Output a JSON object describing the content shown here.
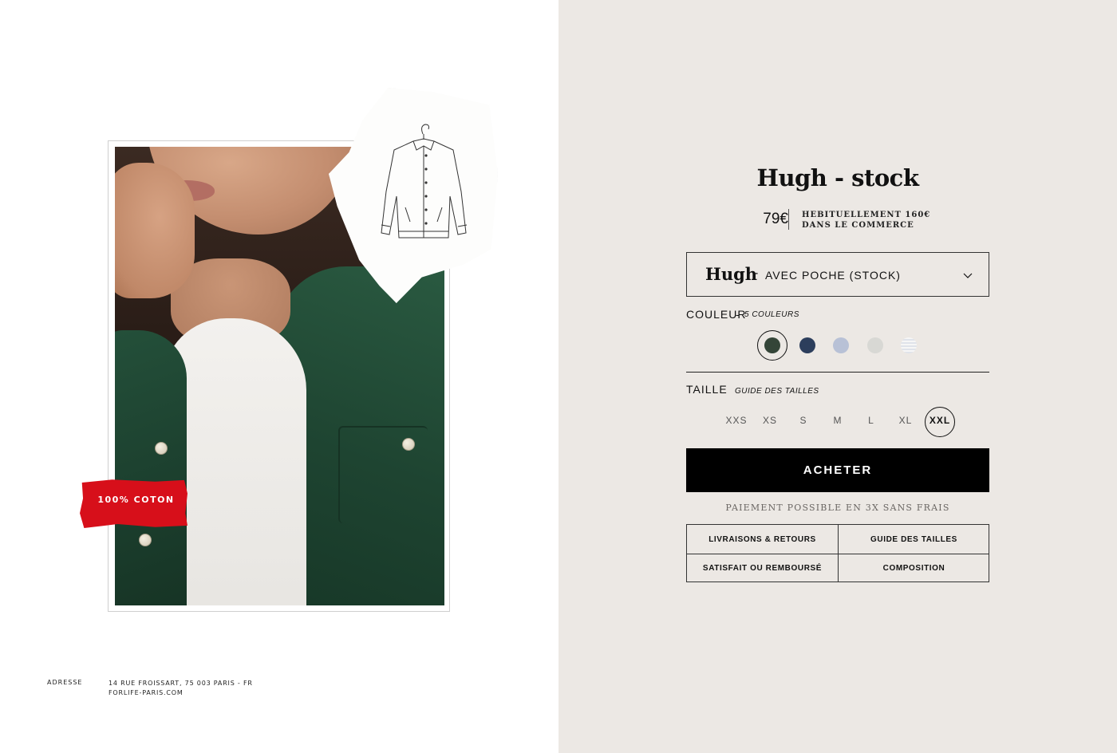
{
  "product": {
    "title": "Hugh - stock",
    "price": "79€",
    "price_note_line1": "HEBITUELLEMENT 160€",
    "price_note_line2": "DANS LE COMMERCE"
  },
  "selector": {
    "name": "Hugh",
    "dash": "-",
    "variant": "AVEC POCHE (STOCK)",
    "icon": "chevron-down-icon"
  },
  "color_section": {
    "label": "COULEUR",
    "separator": "-",
    "sub": "5 COULEURS",
    "swatches": [
      {
        "color": "#344538",
        "selected": true
      },
      {
        "color": "#2c3e5c",
        "selected": false
      },
      {
        "color": "#b8c1d6",
        "selected": false
      },
      {
        "color": "#d8d8d4",
        "selected": false
      },
      {
        "color": "#dfe3ea",
        "selected": false,
        "striped": true
      }
    ]
  },
  "size_section": {
    "label": "TAILLE",
    "guide_link": "GUIDE DES TAILLES",
    "sizes": [
      "XXS",
      "XS",
      "S",
      "M",
      "L",
      "XL",
      "XXL"
    ],
    "selected": "XXL"
  },
  "buy_button": "ACHETER",
  "payment_note": "PAIEMENT POSSIBLE EN 3X SANS FRAIS",
  "info_links": [
    "LIVRAISONS & RETOURS",
    "GUIDE DES TAILLES",
    "SATISFAIT OU REMBOURSÉ",
    "COMPOSITION"
  ],
  "badge": "100% COTON",
  "footer": {
    "label": "ADRESSE",
    "address_line1": "14 RUE FROISSART, 75 003 PARIS - FR",
    "address_line2": "FORLIFE-PARIS.COM"
  },
  "colors": {
    "right_bg": "#ece8e4",
    "badge_red": "#d70f1a",
    "button_black": "#000000"
  }
}
